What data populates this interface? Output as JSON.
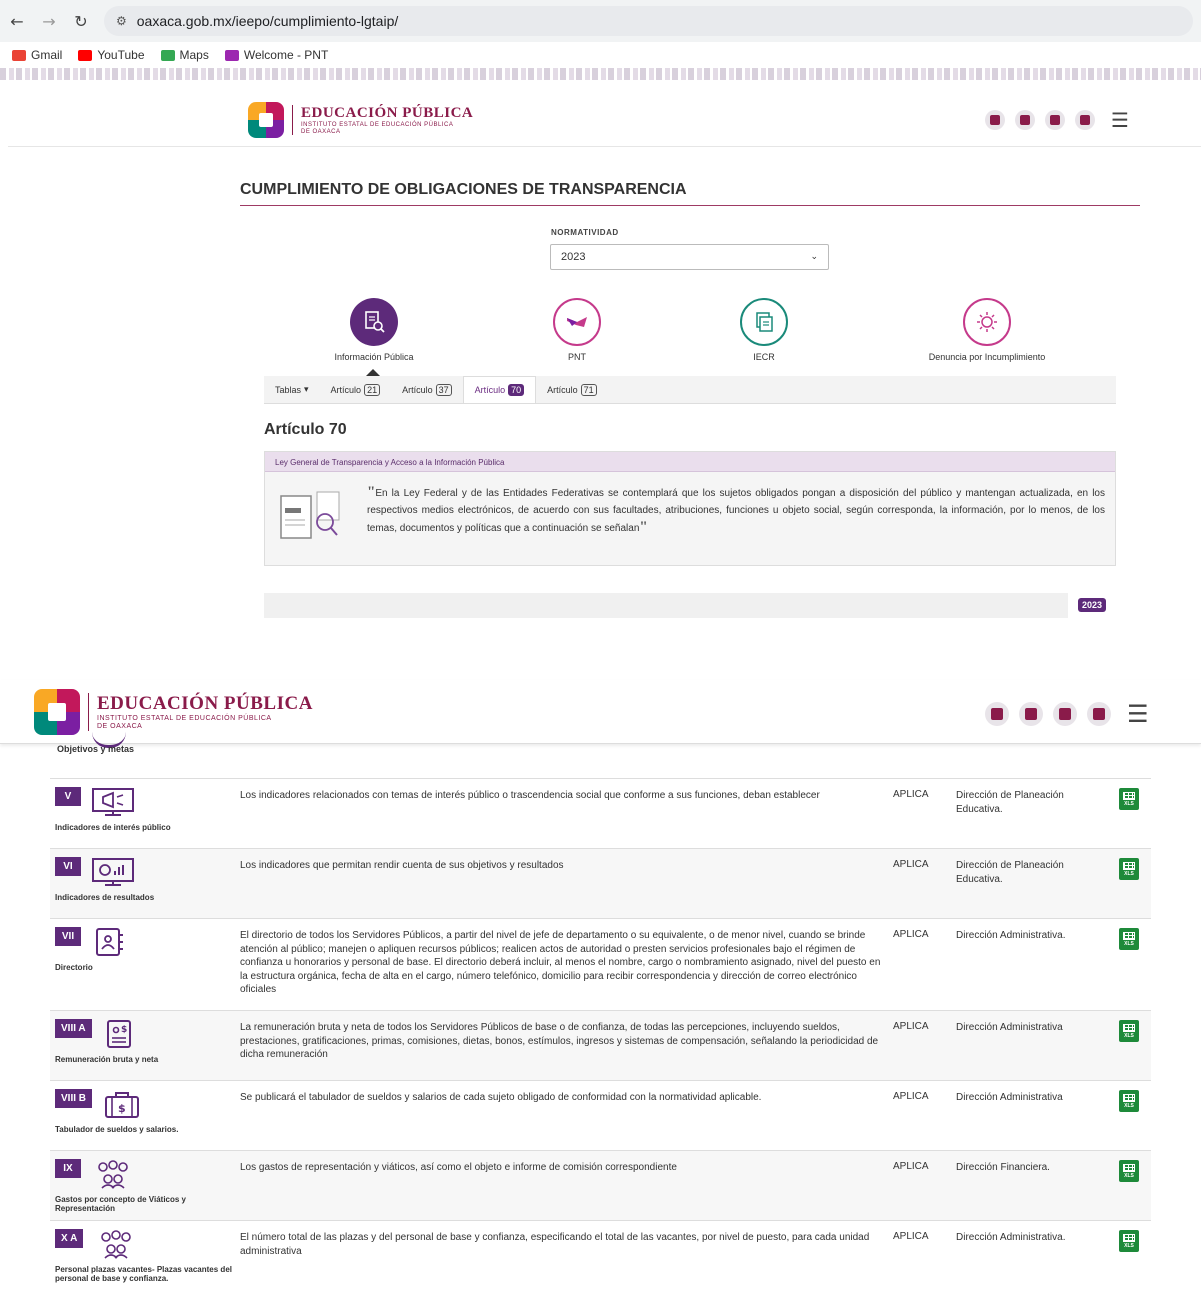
{
  "browser": {
    "url": "oaxaca.gob.mx/ieepo/cumplimiento-lgtaip/",
    "bookmarks": [
      "Gmail",
      "YouTube",
      "Maps",
      "Welcome - PNT"
    ]
  },
  "logo": {
    "title": "EDUCACIÓN PÚBLICA",
    "sub1": "INSTITUTO ESTATAL DE EDUCACIÓN PÚBLICA",
    "sub2": "DE OAXACA"
  },
  "page_title": "CUMPLIMIENTO DE OBLIGACIONES DE TRANSPARENCIA",
  "normatividad": {
    "label": "NORMATIVIDAD",
    "selected": "2023"
  },
  "categories": [
    {
      "label": "Información Pública",
      "icon": "document-search-icon"
    },
    {
      "label": "PNT",
      "icon": "pnt-logo-icon"
    },
    {
      "label": "IECR",
      "icon": "folders-icon"
    },
    {
      "label": "Denuncia por Incumplimiento",
      "icon": "alert-complaint-icon"
    }
  ],
  "tabs": [
    {
      "label": "Tablas",
      "badge": "",
      "caret": "▾"
    },
    {
      "label": "Artículo",
      "badge": "21"
    },
    {
      "label": "Artículo",
      "badge": "37"
    },
    {
      "label": "Artículo",
      "badge": "70"
    },
    {
      "label": "Artículo",
      "badge": "71"
    }
  ],
  "article": {
    "title": "Artículo 70",
    "law_header": "Ley General de Transparencia y Acceso a la Información Pública",
    "law_text": "En la Ley Federal y de las Entidades Federativas se contemplará que los sujetos obligados pongan a disposición del público y mantengan actualizada, en los respectivos medios electrónicos, de acuerdo con sus facultades, atribuciones, funciones u objeto social, según corresponda, la información, por lo menos, de los temas, documentos y políticas que a continuación se señalan"
  },
  "year_badge": "2023",
  "prev_row_name": "Objetivos y metas",
  "rows": [
    {
      "num": "V",
      "name": "Indicadores de interés público",
      "icon": "megaphone-monitor-icon",
      "desc": "Los indicadores relacionados con temas de interés público o trascendencia social que conforme a sus funciones, deban establecer",
      "status": "APLICA",
      "unit": "Dirección de Planeación Educativa."
    },
    {
      "num": "VI",
      "name": "Indicadores de resultados",
      "icon": "chart-monitor-icon",
      "desc": "Los indicadores que permitan rendir cuenta de sus objetivos y resultados",
      "status": "APLICA",
      "unit": "Dirección de Planeación Educativa."
    },
    {
      "num": "VII",
      "name": "Directorio",
      "icon": "directory-book-icon",
      "desc": "El directorio de todos los Servidores Públicos, a partir del nivel de jefe de departamento o su equivalente, o de menor nivel, cuando se brinde atención al público; manejen o apliquen recursos públicos; realicen actos de autoridad o presten servicios profesionales bajo el régimen de confianza u honorarios y personal de base. El directorio deberá incluir, al menos el nombre, cargo o nombramiento asignado, nivel del puesto en la estructura orgánica, fecha de alta en el cargo, número telefónico, domicilio para recibir correspondencia y dirección de correo electrónico oficiales",
      "status": "APLICA",
      "unit": "Dirección Administrativa."
    },
    {
      "num": "VIII A",
      "name": "Remuneración bruta y neta",
      "icon": "salary-document-icon",
      "desc": "La remuneración bruta y neta de todos los Servidores Públicos de base o de confianza, de todas las percepciones, incluyendo sueldos, prestaciones, gratificaciones, primas, comisiones, dietas, bonos, estímulos, ingresos y sistemas de compensación, señalando la periodicidad de dicha remuneración",
      "status": "APLICA",
      "unit": "Dirección Administrativa"
    },
    {
      "num": "VIII B",
      "name": "Tabulador de sueldos y salarios.",
      "icon": "briefcase-money-icon",
      "desc": "Se publicará el tabulador de sueldos y salarios de cada sujeto obligado de conformidad con la normatividad aplicable.",
      "status": "APLICA",
      "unit": "Dirección Administrativa"
    },
    {
      "num": "IX",
      "name": "Gastos por concepto de Viáticos y Representación",
      "icon": "people-group-icon",
      "desc": "Los gastos de representación y viáticos, así como el objeto e informe de comisión correspondiente",
      "status": "APLICA",
      "unit": "Dirección Financiera."
    },
    {
      "num": "X A",
      "name": "Personal plazas vacantes- Plazas vacantes del personal de base y confianza.",
      "icon": "people-group-icon",
      "desc": "El número total de las plazas y del personal de base y confianza, especificando el total de las vacantes, por nivel de puesto, para cada unidad administrativa",
      "status": "APLICA",
      "unit": "Dirección Administrativa."
    }
  ],
  "xls_label": "XLS"
}
